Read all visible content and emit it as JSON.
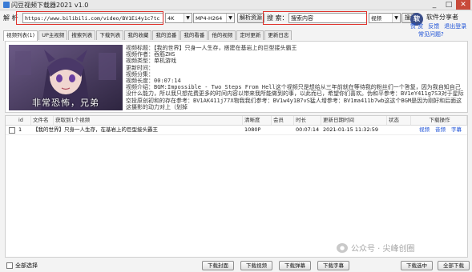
{
  "window": {
    "title": "闪豆视频下载器2021 v1.0",
    "minimize": "_",
    "maximize": "□",
    "close": "✕"
  },
  "toolbar": {
    "url_label": "解 析",
    "url_value": "https://www.bilibili.com/video/BV1Ei4y1c7tc",
    "quality": "4K",
    "format": "MP4-H264",
    "parse_button": "解析资源",
    "search_label": "搜 索：",
    "search_placeholder": "搜索内容",
    "search_type": "视频",
    "search_button": "搜索"
  },
  "brand": {
    "name": "软件分享者",
    "links": [
      "赞 赏",
      "反馈",
      "退出登录"
    ],
    "faq": "常见问题?"
  },
  "tabs": [
    "视频列表(1)",
    "UP主视频",
    "搜索列表",
    "下载列表",
    "我的收藏",
    "我的追番",
    "我的看番",
    "他的视频",
    "定时更新",
    "更新日志"
  ],
  "video": {
    "thumbnail_caption": "非常恐怖，兄弟",
    "title": "视频标题：【我的世界】只身一人生存，搭建在基岩上的巨型接头霸王",
    "author": "视频作者：吞筋ZHS",
    "type": "视频类型：单机游戏",
    "update_time": "更新时间：",
    "parts": "视频分集：",
    "duration": "视频长度：00:07:14",
    "description": "视频介绍：BGM:Impossible - Two Steps From Hell这个视频只是想给从三年前就在等待我的粉丝们一个答复，因为我自知自己没什么能力，所以我只想花费更多的时间内容以带来我所能做到的事，以此而已，希望你们喜欢。伪和平参考：BV1eY411g7S3对于星际空投原创初和的存在参考：BV1AK411j77X物我我们参考：BV1w4y1B7vS猛人增参考：BV1ma411b7wb这这个BGM是因为刚好和后面这这摄影的动力对上（划掉"
  },
  "grid": {
    "headers": [
      "id",
      "文件名",
      "获取到1个视频",
      "清晰度",
      "会员",
      "时长",
      "更新日期时间",
      "状态",
      "下载操作"
    ],
    "rows": [
      {
        "id": "1",
        "filename": "【我的世界】只身一人生存，在基岩上的巨型接头霸王",
        "quality": "1080P",
        "vip": "",
        "duration": "00:07:14",
        "datetime": "2021-01-15 11:32:59",
        "status": "",
        "ops": [
          "视频",
          "音频",
          "字幕"
        ]
      }
    ]
  },
  "watermark": "公众号 · 尖峰创圈",
  "bottom": {
    "select_all": "全部选择",
    "buttons": [
      "下载封面",
      "下载视频",
      "下载弹幕",
      "下载字幕",
      "下载选中",
      "全部下载"
    ]
  },
  "colors": {
    "highlight_frame": "#e0312b",
    "link": "#1a4fd6"
  }
}
